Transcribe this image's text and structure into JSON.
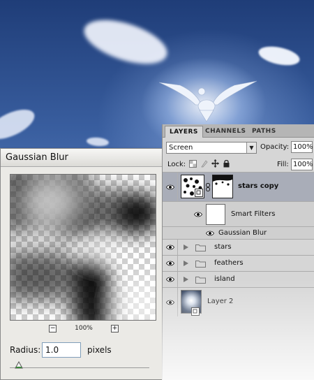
{
  "dialog": {
    "title": "Gaussian Blur",
    "zoom_level": "100%",
    "zoom_out_label": "−",
    "zoom_in_label": "+",
    "radius_label": "Radius:",
    "radius_value": "1.0",
    "radius_unit": "pixels"
  },
  "layers_panel": {
    "tabs": [
      {
        "label": "LAYERS",
        "active": true
      },
      {
        "label": "CHANNELS",
        "active": false
      },
      {
        "label": "PATHS",
        "active": false
      }
    ],
    "blend_mode": "Screen",
    "opacity_label": "Opacity:",
    "opacity_value": "100%",
    "lock_label": "Lock:",
    "fill_label": "Fill:",
    "fill_value": "100%",
    "layers": [
      {
        "name": "stars copy",
        "selected": true,
        "visible": true
      },
      {
        "name": "Smart Filters",
        "visible": true
      },
      {
        "name": "Gaussian Blur",
        "visible": true
      },
      {
        "name": "stars",
        "type": "group",
        "visible": true
      },
      {
        "name": "feathers",
        "type": "group",
        "visible": true
      },
      {
        "name": "island",
        "type": "group",
        "visible": true
      },
      {
        "name": "Layer 2",
        "visible": true
      }
    ]
  },
  "icons": {
    "eye": "eye-icon",
    "folder": "folder-icon",
    "triangle": "expand-triangle-icon",
    "chain": "link-icon",
    "lock_transparent": "lock-transparent-icon",
    "lock_image": "lock-image-icon",
    "lock_position": "lock-position-icon",
    "lock_all": "lock-all-icon",
    "smart_object": "smart-object-icon"
  },
  "colors": {
    "selected_row": "#a9adb8",
    "panel_bg": "#d6d6d6",
    "dialog_bg": "#ebeae6"
  }
}
